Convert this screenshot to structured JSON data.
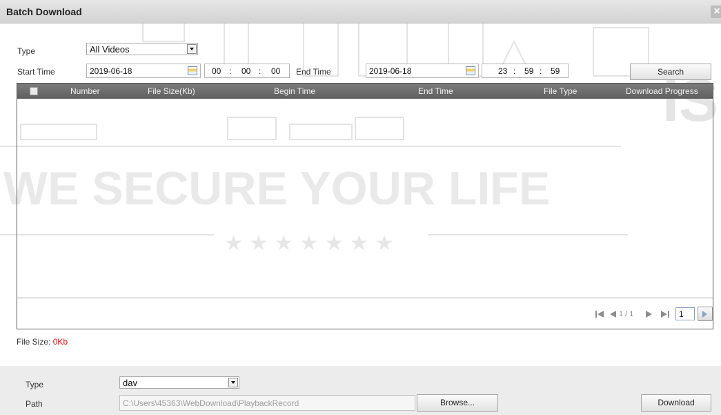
{
  "dialog": {
    "title": "Batch Download",
    "close_icon": "close-icon"
  },
  "watermark": {
    "slogan": "WE SECURE YOUR LIFE",
    "stars": "★ ★ ★ ★ ★ ★ ★",
    "corner": "IS"
  },
  "filters": {
    "type_label": "Type",
    "type_value": "All Videos",
    "start_label": "Start Time",
    "start_date": "2019-06-18",
    "start_time": {
      "h": "00",
      "m": "00",
      "s": "00"
    },
    "end_label": "End Time",
    "end_date": "2019-06-18",
    "end_time": {
      "h": "23",
      "m": "59",
      "s": "59"
    },
    "sep": ":",
    "search_label": "Search"
  },
  "table": {
    "columns": [
      "Number",
      "File Size(Kb)",
      "Begin Time",
      "End Time",
      "File Type",
      "Download Progress"
    ],
    "rows": []
  },
  "pager": {
    "info": "1 / 1",
    "page_input": "1",
    "icons": [
      "first-page-icon",
      "prev-page-icon",
      "next-page-icon",
      "last-page-icon",
      "go-icon"
    ]
  },
  "file_size": {
    "label": "File Size: ",
    "value": "0Kb",
    "value_color": "#ff0000"
  },
  "download": {
    "type_label": "Type",
    "type_value": "dav",
    "path_label": "Path",
    "path_value": "C:\\Users\\45363\\WebDownload\\PlaybackRecord",
    "browse_label": "Browse...",
    "download_label": "Download"
  }
}
